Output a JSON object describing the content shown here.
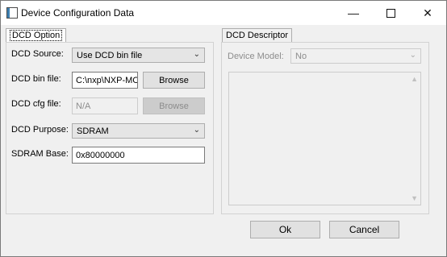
{
  "window": {
    "title": "Device Configuration Data",
    "controls": {
      "minimize": "—",
      "close": "✕"
    }
  },
  "dcd_option": {
    "tab_label": "DCD Option",
    "source": {
      "label": "DCD Source:",
      "value": "Use DCD bin file"
    },
    "bin_file": {
      "label": "DCD bin file:",
      "value": "C:\\nxp\\NXP-MC",
      "browse": "Browse"
    },
    "cfg_file": {
      "label": "DCD cfg file:",
      "value": "N/A",
      "browse": "Browse"
    },
    "purpose": {
      "label": "DCD Purpose:",
      "value": "SDRAM"
    },
    "sdram_base": {
      "label": "SDRAM Base:",
      "value": "0x80000000"
    }
  },
  "dcd_descriptor": {
    "tab_label": "DCD Descriptor",
    "device_model": {
      "label": "Device Model:",
      "value": "No"
    }
  },
  "buttons": {
    "ok": "Ok",
    "cancel": "Cancel"
  },
  "icons": {
    "combo_arrow": "chevron-down-icon",
    "scroll_up": "▲",
    "scroll_down": "▼",
    "dropdown": "⌄"
  }
}
